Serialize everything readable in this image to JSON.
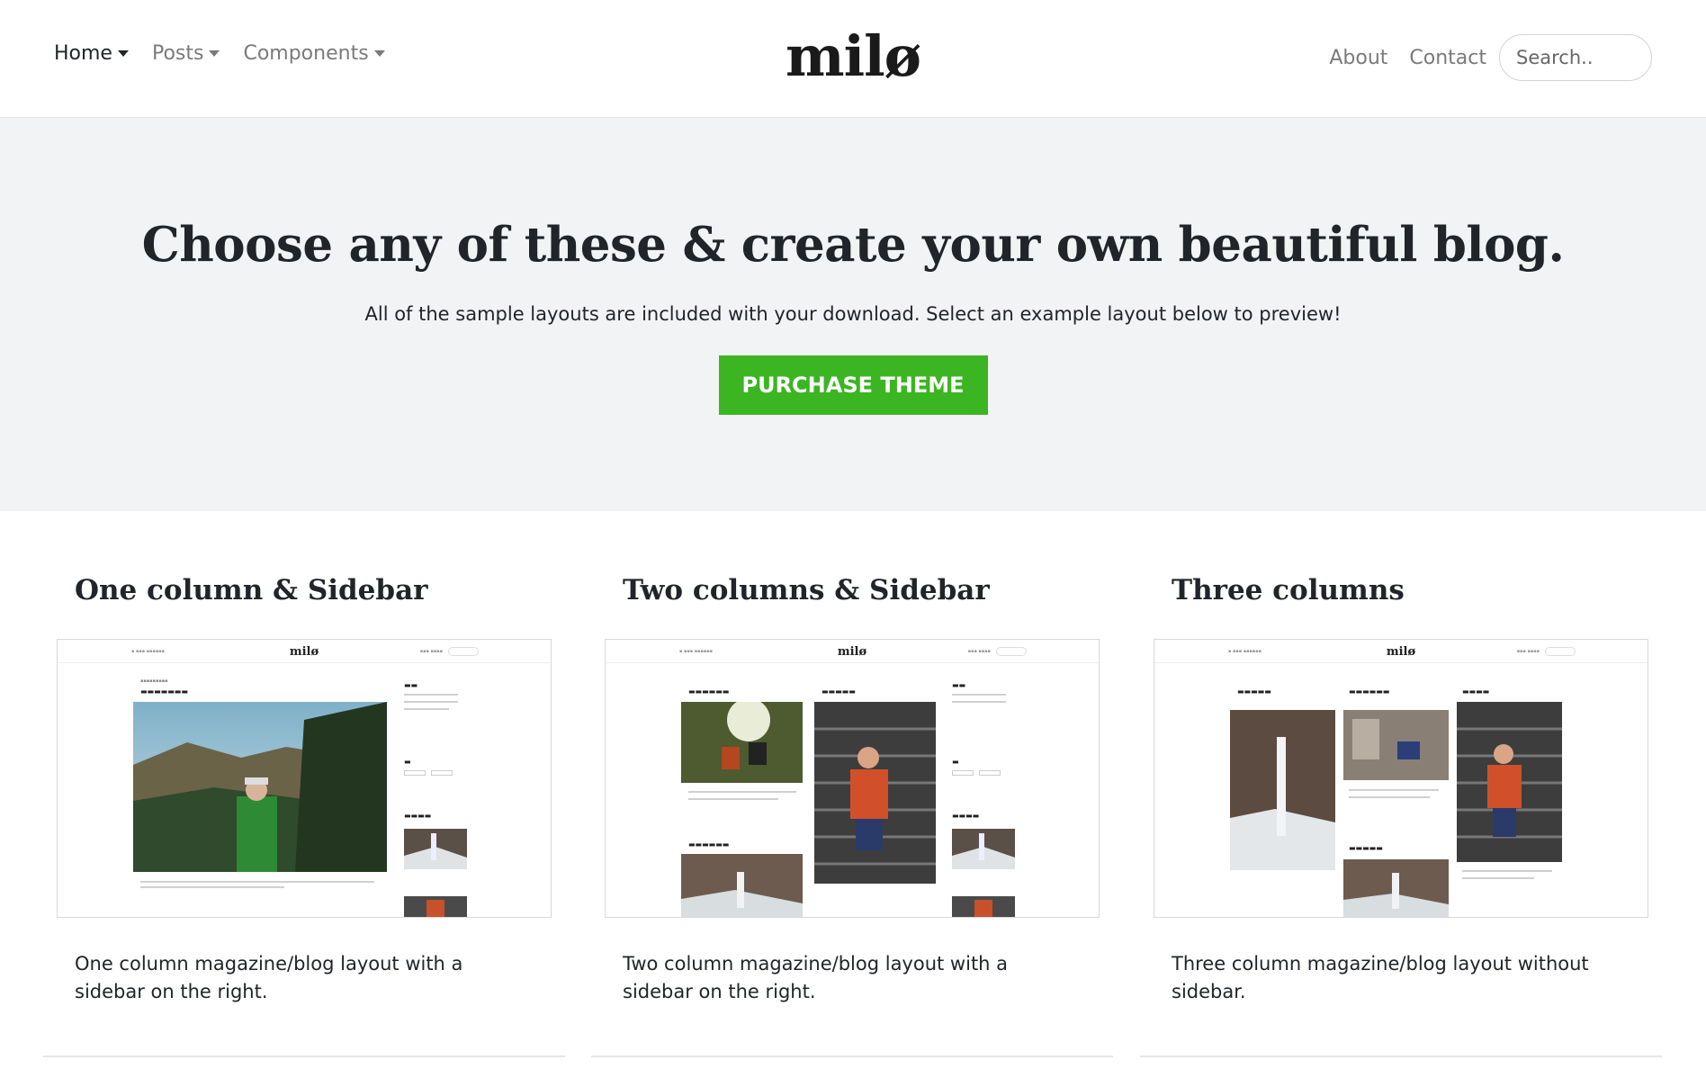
{
  "nav": {
    "items": [
      {
        "label": "Home",
        "active": true
      },
      {
        "label": "Posts",
        "active": false
      },
      {
        "label": "Components",
        "active": false
      }
    ],
    "brand": "milø",
    "about": "About",
    "contact": "Contact",
    "search_placeholder": "Search.."
  },
  "hero": {
    "title": "Choose any of these & create your own beautiful blog.",
    "subtitle": "All of the sample layouts are included with your download. Select an example layout below to preview!",
    "cta_label": "PURCHASE THEME",
    "cta_color": "#3cb522",
    "background": "#f2f3f5"
  },
  "layouts": [
    {
      "title": "One column & Sidebar",
      "description": "One column magazine/blog layout with a sidebar on the right."
    },
    {
      "title": "Two columns & Sidebar",
      "description": "Two column magazine/blog layout with a sidebar on the right."
    },
    {
      "title": "Three columns",
      "description": "Three column magazine/blog layout without sidebar."
    }
  ]
}
